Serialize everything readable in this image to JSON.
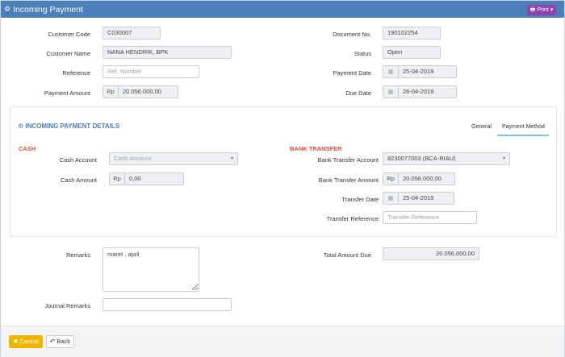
{
  "header": {
    "title": "Incoming Payment",
    "print_label": "Print",
    "gear_icon": "gear-icon"
  },
  "customer": {
    "code_label": "Customer Code",
    "code_value": "C030007",
    "name_label": "Customer Name",
    "name_value": "NANA HENDRIK, BPK",
    "reference_label": "Reference",
    "reference_placeholder": "Ref. Number",
    "amount_label": "Payment Amount",
    "amount_prefix": "Rp",
    "amount_value": "20.056.000,00"
  },
  "document": {
    "doc_label": "Document No.",
    "doc_value": "190102254",
    "status_label": "Status",
    "status_value": "Open",
    "payment_date_label": "Payment Date",
    "payment_date_value": "25-04-2019",
    "due_date_label": "Due Date",
    "due_date_value": "26-04-2019"
  },
  "details": {
    "title": "INCOMING PAYMENT DETAILS",
    "tabs": [
      {
        "label": "General"
      },
      {
        "label": "Payment Method"
      }
    ],
    "cash": {
      "heading": "CASH",
      "account_label": "Cash Account",
      "account_value": "Cash Account",
      "amount_label": "Cash Amount",
      "amount_prefix": "Rp",
      "amount_value": "0,00"
    },
    "bank": {
      "heading": "BANK TRANSFER",
      "account_label": "Bank Transfer Account",
      "account_value": "8230077003 (BCA-RIAU)",
      "amount_label": "Bank Transfer Amount",
      "amount_prefix": "Rp",
      "amount_value": "20.056.000,00",
      "date_label": "Transfer Date",
      "date_value": "25-04-2019",
      "ref_label": "Transfer Reference",
      "ref_placeholder": "Transfer Reference"
    }
  },
  "bottom": {
    "remarks_label": "Remarks",
    "remarks_value": "maret , april",
    "journal_label": "Journal Remarks",
    "journal_value": "",
    "total_label": "Total Amount Due",
    "total_value": "20.056.000,00"
  },
  "footer": {
    "cancel_label": "Cancel",
    "back_label": "Back"
  },
  "colors": {
    "header": "#4a7fb8",
    "print": "#8e44ad",
    "cancel": "#f0b400",
    "heading_red": "#e74c3c"
  }
}
